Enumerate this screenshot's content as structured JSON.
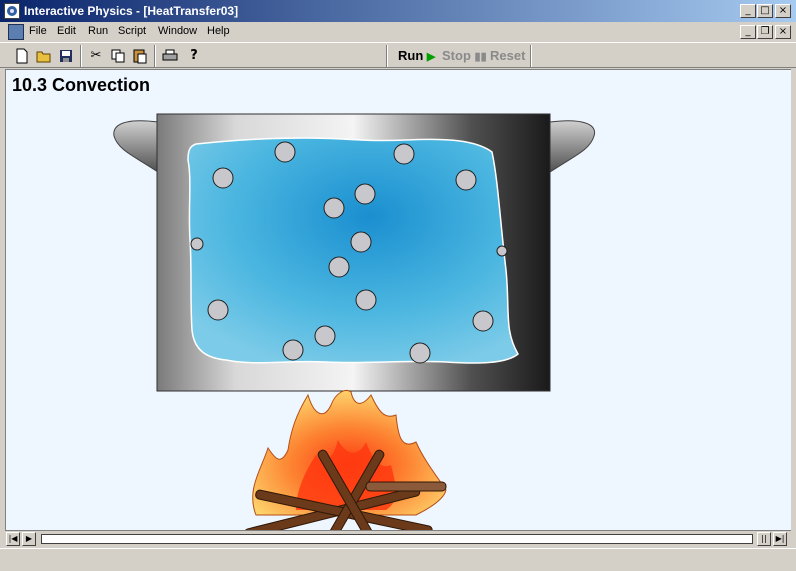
{
  "window": {
    "title": "Interactive Physics - [HeatTransfer03]"
  },
  "menu": [
    "File",
    "Edit",
    "Run",
    "Script",
    "Window",
    "Help"
  ],
  "toolbar": {
    "icons": [
      "new-file-icon",
      "open-folder-icon",
      "save-icon",
      "cut-icon",
      "copy-icon",
      "paste-icon",
      "print-icon",
      "help-icon"
    ],
    "run_label": "Run",
    "stop_label": "Stop",
    "reset_label": "Reset"
  },
  "page": {
    "title": "10.3 Convection"
  },
  "colors": {
    "water": "#2fa6d8",
    "pot": "#9a9a9a",
    "particle": "#c8c8cc",
    "flame": "#ff6a18"
  }
}
